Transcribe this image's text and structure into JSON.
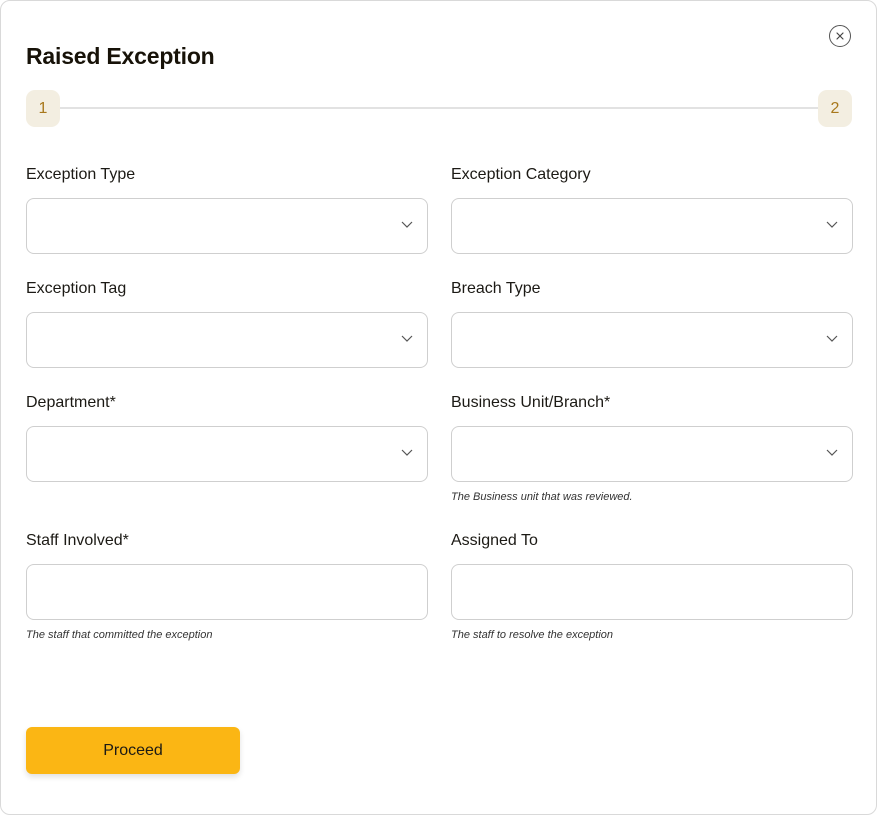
{
  "modal": {
    "title": "Raised Exception",
    "close_icon": "close-icon"
  },
  "stepper": {
    "steps": [
      "1",
      "2"
    ],
    "current_step": 1
  },
  "form": {
    "exception_type": {
      "label": "Exception Type",
      "value": ""
    },
    "exception_category": {
      "label": "Exception Category",
      "value": ""
    },
    "exception_tag": {
      "label": "Exception Tag",
      "value": ""
    },
    "breach_type": {
      "label": "Breach Type",
      "value": ""
    },
    "department": {
      "label": "Department*",
      "value": ""
    },
    "business_unit": {
      "label": "Business Unit/Branch*",
      "value": "",
      "helper": "The Business unit that was reviewed."
    },
    "staff_involved": {
      "label": "Staff Involved*",
      "value": "",
      "helper": "The staff that committed the exception"
    },
    "assigned_to": {
      "label": "Assigned To",
      "value": "",
      "helper": "The staff to resolve the exception"
    }
  },
  "actions": {
    "proceed_label": "Proceed"
  },
  "colors": {
    "accent": "#fbb614",
    "step_bg": "#f3eee1",
    "step_text": "#a8781c"
  }
}
